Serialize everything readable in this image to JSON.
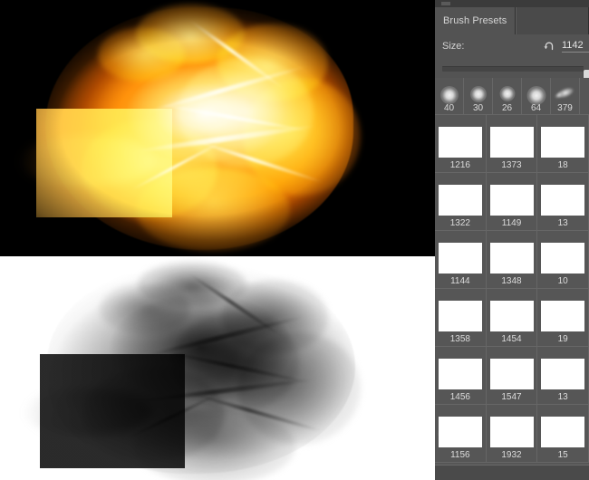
{
  "panel": {
    "tabs": [
      {
        "label": "Brush Presets",
        "active": true
      },
      {
        "label": "",
        "active": false
      }
    ],
    "size_control": {
      "label": "Size:",
      "reset_icon": "reset-arrow-icon",
      "value": "1142",
      "slider_percent": 100
    },
    "round_brushes": [
      {
        "label": "40",
        "diameter": 20
      },
      {
        "label": "30",
        "diameter": 18
      },
      {
        "label": "26",
        "diameter": 17
      },
      {
        "label": "64",
        "diameter": 21
      },
      {
        "label": "379",
        "diameter": 22
      }
    ],
    "texture_brush_rows": [
      [
        {
          "label": "1216"
        },
        {
          "label": "1373"
        },
        {
          "label": "18"
        }
      ],
      [
        {
          "label": "1322"
        },
        {
          "label": "1149"
        },
        {
          "label": "13"
        }
      ],
      [
        {
          "label": "1144"
        },
        {
          "label": "1348"
        },
        {
          "label": "10"
        }
      ],
      [
        {
          "label": "1358"
        },
        {
          "label": "1454"
        },
        {
          "label": "19"
        }
      ],
      [
        {
          "label": "1456"
        },
        {
          "label": "1547"
        },
        {
          "label": "13"
        }
      ],
      [
        {
          "label": "1156"
        },
        {
          "label": "1932"
        },
        {
          "label": "15"
        }
      ]
    ],
    "colors": {
      "panel_background": "#535353",
      "grid_background": "#565656",
      "tab_bar": "#3b3b3b",
      "text": "#d6d6d6",
      "grid_line": "#666666"
    }
  },
  "preview_images": {
    "top": {
      "name": "fireball-explosion-photo",
      "background": "#000000",
      "description": "Fireball explosion on black background"
    },
    "bottom": {
      "name": "smoke-brush-grayscale-preview",
      "background": "#ffffff",
      "description": "Inverted grayscale smoke cloud on white background"
    }
  }
}
